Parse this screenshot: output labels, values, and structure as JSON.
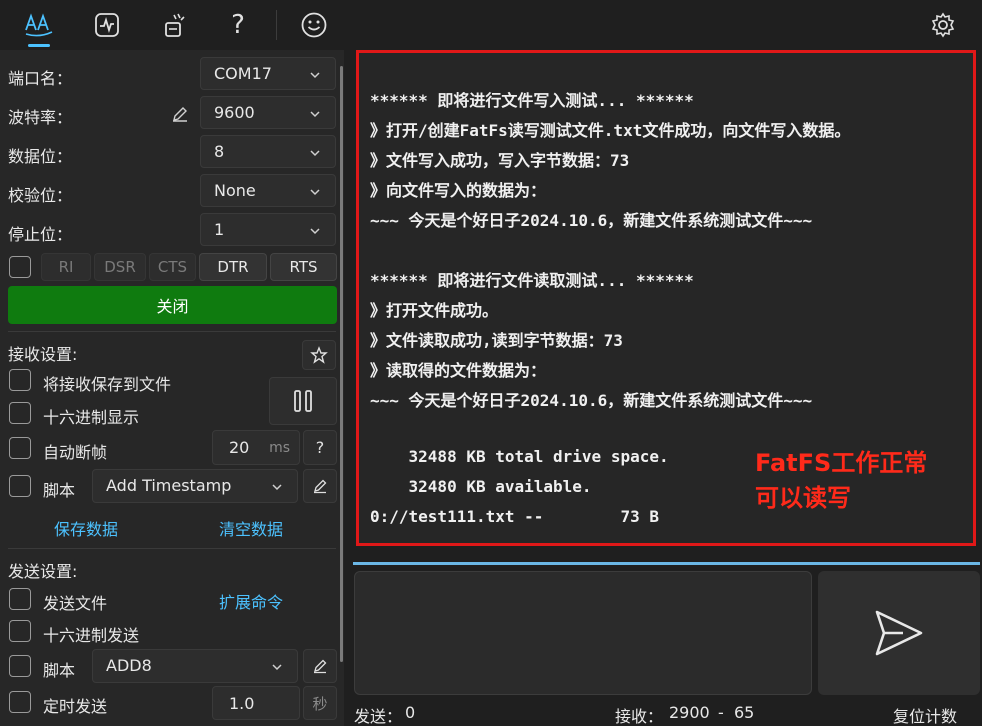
{
  "toolbar": {
    "icons": [
      "text-font-icon",
      "activity-icon",
      "magic-wand-icon",
      "help-icon",
      "smiley-icon",
      "gear-icon"
    ],
    "accent": "#4cc2ff"
  },
  "port": {
    "port_label": "端口名：",
    "port_value": "COM17",
    "baud_label": "波特率：",
    "baud_value": "9600",
    "databits_label": "数据位：",
    "databits_value": "8",
    "parity_label": "校验位：",
    "parity_value": "None",
    "stopbits_label": "停止位：",
    "stopbits_value": "1",
    "signals": [
      "RI",
      "DSR",
      "CTS",
      "DTR",
      "RTS"
    ],
    "open_button": "关闭",
    "open_button_color": "#0f7b0f"
  },
  "receive": {
    "title": "接收设置:",
    "save_to_file": "将接收保存到文件",
    "hex_display": "十六进制显示",
    "auto_frame": "自动断帧",
    "auto_frame_value": "20",
    "auto_frame_unit": "ms",
    "help": "?",
    "script_label": "脚本",
    "script_value": "Add Timestamp",
    "save_data": "保存数据",
    "clear_data": "清空数据"
  },
  "send": {
    "title": "发送设置:",
    "send_file": "发送文件",
    "extend_cmd": "扩展命令",
    "hex_send": "十六进制发送",
    "script_label": "脚本",
    "script_value": "ADD8",
    "timed_send": "定时发送",
    "timed_value": "1.0",
    "timed_unit": "秒"
  },
  "terminal": {
    "lines": [
      "****** 即将进行文件写入测试... ******",
      "》打开/创建FatFs读写测试文件.txt文件成功，向文件写入数据。",
      "》文件写入成功，写入字节数据：73",
      "》向文件写入的数据为：",
      "~~~ 今天是个好日子2024.10.6，新建文件系统测试文件~~~",
      "",
      "****** 即将进行文件读取测试... ******",
      "》打开文件成功。",
      "》文件读取成功,读到字节数据：73",
      "》读取得的文件数据为：",
      "~~~ 今天是个好日子2024.10.6，新建文件系统测试文件~~~",
      "",
      "",
      "    32488 KB total drive space.",
      "    32480 KB available.",
      "0://test111.txt --        73 B"
    ],
    "annotation_line1": "FatFS工作正常",
    "annotation_line2": "可以读写",
    "border_color": "#e01818",
    "annotation_color": "#ff2a1a"
  },
  "status": {
    "sent_label": "发送：",
    "sent_value": "0",
    "recv_label": "接收：",
    "recv_value": "2900",
    "recv_sep": "-",
    "recv_extra": "65",
    "reset": "复位计数"
  }
}
